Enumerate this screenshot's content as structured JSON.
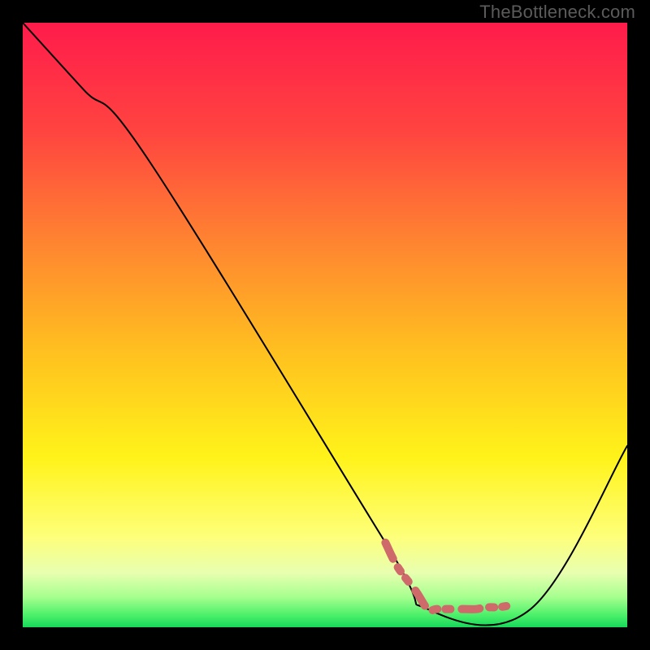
{
  "watermark": {
    "text": "TheBottleneck.com"
  },
  "chart_data": {
    "type": "line",
    "title": "",
    "xlabel": "",
    "ylabel": "",
    "xlim": [
      0,
      100
    ],
    "ylim": [
      0,
      100
    ],
    "grid": false,
    "legend": false,
    "series": [
      {
        "name": "curve",
        "x": [
          0,
          10,
          21,
          60,
          67,
          84,
          100
        ],
        "y": [
          100,
          89,
          77,
          14,
          3,
          3,
          30
        ],
        "color": "#000000",
        "width": 2
      },
      {
        "name": "highlight",
        "x": [
          60,
          62,
          65,
          67,
          68.5,
          71,
          73,
          75,
          76.5,
          78.5,
          80
        ],
        "y": [
          14,
          10,
          6,
          3,
          3,
          3,
          3,
          3,
          3.3,
          3.3,
          3.5
        ],
        "color": "#cf6a6a",
        "width": 10,
        "dashed": true
      }
    ],
    "gradient_stops": [
      {
        "offset": 0.0,
        "color": "#ff1b4b"
      },
      {
        "offset": 0.18,
        "color": "#ff4440"
      },
      {
        "offset": 0.38,
        "color": "#ff8a2f"
      },
      {
        "offset": 0.55,
        "color": "#ffc21f"
      },
      {
        "offset": 0.72,
        "color": "#fff31a"
      },
      {
        "offset": 0.85,
        "color": "#feff7a"
      },
      {
        "offset": 0.91,
        "color": "#e8ffb0"
      },
      {
        "offset": 0.95,
        "color": "#a6ff8f"
      },
      {
        "offset": 0.98,
        "color": "#4cf06a"
      },
      {
        "offset": 1.0,
        "color": "#17d85a"
      }
    ]
  }
}
